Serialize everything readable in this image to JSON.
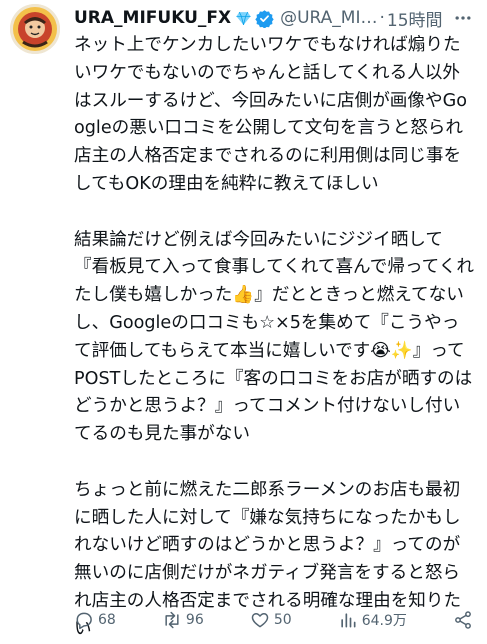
{
  "tweet": {
    "display_name": "URA_MIFUKU_FX",
    "handle": "@URA_MI…",
    "separator": "·",
    "time": "15時間",
    "more_icon": "more-dots-icon",
    "paragraphs": [
      "ネット上でケンカしたいワケでもなければ煽りたいワケでもないのでちゃんと話してくれる人以外はスルーするけど、今回みたいに店側が画像やGoogleの悪い口コミを公開して文句を言うと怒られ店主の人格否定までされるのに利用側は同じ事をしてもOKの理由を純粋に教えてほしい",
      "結果論だけど例えば今回みたいにジジイ晒して『看板見て入って食事してくれて喜んで帰ってくれたし僕も嬉しかった👍』だとときっと燃えてないし、Googleの口コミも☆×5を集めて『こうやって評価してもらえて本当に嬉しいです😭✨』ってPOSTしたところに『客の口コミをお店が晒すのはどうかと思うよ？』ってコメント付けないし付いてるのも見た事がない",
      "ちょっと前に燃えた二郎系ラーメンのお店も最初に晒した人に対して『嫌な気持ちになったかもしれないけど晒すのはどうかと思うよ？』ってのが無いのに店側だけがネガティブ発言をすると怒られ店主の人格否定までされる明確な理由を知りたい"
    ]
  },
  "actions": {
    "replies": "68",
    "reposts": "96",
    "likes": "50",
    "views": "64.9万"
  },
  "colors": {
    "text": "#0f1419",
    "secondary": "#536471",
    "verified": "#1d9bf0"
  }
}
